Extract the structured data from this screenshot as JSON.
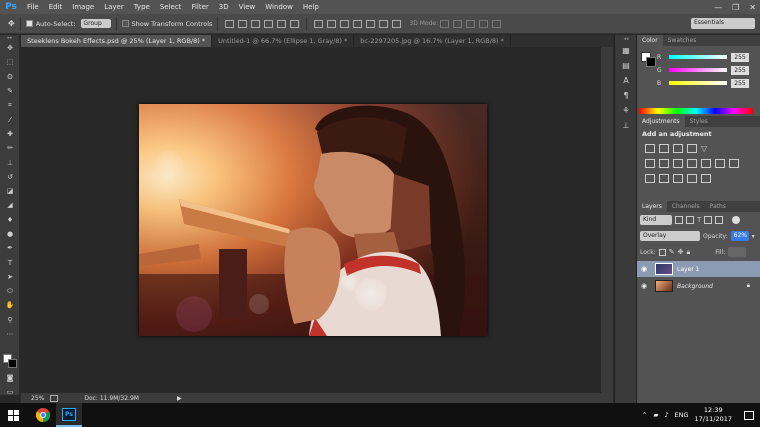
{
  "app": {
    "logo": "Ps"
  },
  "menu": [
    "File",
    "Edit",
    "Image",
    "Layer",
    "Type",
    "Select",
    "Filter",
    "3D",
    "View",
    "Window",
    "Help"
  ],
  "window_controls": [
    "—",
    "❐",
    "✕"
  ],
  "options": {
    "auto_select_label": "Auto-Select:",
    "auto_select_value": "Group",
    "transform_label": "Show Transform Controls",
    "mode_3d": "3D Mode:",
    "workspace": "Essentials"
  },
  "tabs": [
    {
      "label": "Steeklens Bokeh Effects.psd @ 25% (Layer 1, RGB/8) *",
      "active": true
    },
    {
      "label": "Untitled-1 @ 66.7% (Ellipse 1, Gray/8) *",
      "active": false
    },
    {
      "label": "bc-2297205.jpg @ 16.7% (Layer 1, RGB/8) *",
      "active": false
    }
  ],
  "status": {
    "zoom": "25%",
    "doc": "Doc: 11.9M/32.9M"
  },
  "color_panel": {
    "tabs": [
      "Color",
      "Swatches"
    ],
    "r": "255",
    "g": "255",
    "b": "255",
    "r_label": "R",
    "g_label": "G",
    "b_label": "B"
  },
  "adjustments_panel": {
    "tabs": [
      "Adjustments",
      "Styles"
    ],
    "title": "Add an adjustment"
  },
  "layers_panel": {
    "tabs": [
      "Layers",
      "Channels",
      "Paths"
    ],
    "kind": "Kind",
    "blend_mode": "Overlay",
    "opacity_label": "Opacity:",
    "opacity": "62%",
    "lock_label": "Lock:",
    "fill_label": "Fill:",
    "fill": "",
    "layers": [
      {
        "name": "Layer 1",
        "selected": true
      },
      {
        "name": "Background",
        "selected": false
      }
    ]
  },
  "taskbar": {
    "language": "ENG",
    "time": "12:39",
    "date": "17/11/2017"
  },
  "colors": {
    "accent": "#31a8ff",
    "selected_layer": "#8a9bb3"
  }
}
